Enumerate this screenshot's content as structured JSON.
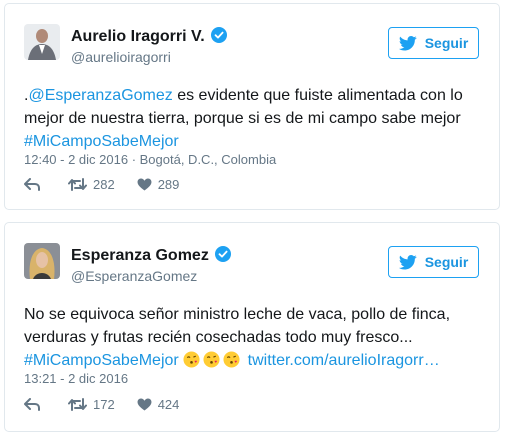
{
  "tweets": [
    {
      "author_name": "Aurelio Iragorri V.",
      "handle": "@aurelioiragorri",
      "follow_label": "Seguir",
      "text_prefix": ".",
      "mention": "@EsperanzaGomez",
      "text_body": " es evidente que fuiste alimentada con lo mejor de nuestra tierra, porque si es de mi campo sabe mejor ",
      "hashtag": "#MiCampoSabeMejor",
      "meta": "12:40 - 2 dic 2016 · Bogotá, D.C., Colombia",
      "retweets": "282",
      "likes": "289"
    },
    {
      "author_name": "Esperanza Gomez",
      "handle": "@EsperanzaGomez",
      "follow_label": "Seguir",
      "text_body": "No se equivoca señor ministro leche de vaca, pollo de finca, verduras y frutas recién cosechadas todo muy fresco... ",
      "hashtag": "#MiCampoSabeMejor",
      "link": "twitter.com/aurelioIragorr…",
      "meta": "13:21 - 2 dic 2016",
      "retweets": "172",
      "likes": "424"
    }
  ],
  "icons": {
    "verified": "verified-badge-icon",
    "bird": "twitter-bird-icon",
    "reply": "reply-icon",
    "retweet": "retweet-icon",
    "like": "heart-icon",
    "emoji": "face-blowing-kiss-emoji"
  },
  "colors": {
    "accent": "#1da1f2",
    "link": "#1b95e0",
    "muted": "#657786",
    "border": "#e1e8ed"
  }
}
